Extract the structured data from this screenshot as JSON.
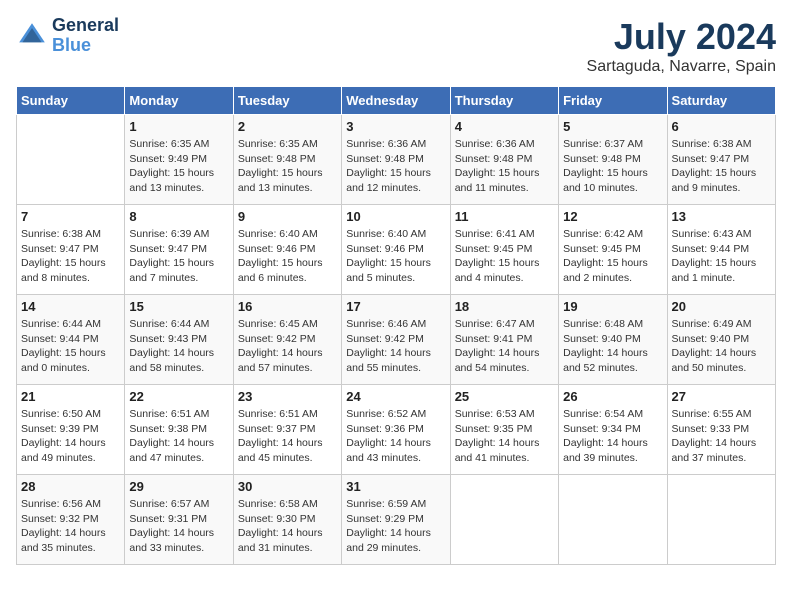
{
  "header": {
    "logo_line1": "General",
    "logo_line2": "Blue",
    "month_year": "July 2024",
    "location": "Sartaguda, Navarre, Spain"
  },
  "days_of_week": [
    "Sunday",
    "Monday",
    "Tuesday",
    "Wednesday",
    "Thursday",
    "Friday",
    "Saturday"
  ],
  "weeks": [
    [
      {
        "day": "",
        "info": ""
      },
      {
        "day": "1",
        "info": "Sunrise: 6:35 AM\nSunset: 9:49 PM\nDaylight: 15 hours\nand 13 minutes."
      },
      {
        "day": "2",
        "info": "Sunrise: 6:35 AM\nSunset: 9:48 PM\nDaylight: 15 hours\nand 13 minutes."
      },
      {
        "day": "3",
        "info": "Sunrise: 6:36 AM\nSunset: 9:48 PM\nDaylight: 15 hours\nand 12 minutes."
      },
      {
        "day": "4",
        "info": "Sunrise: 6:36 AM\nSunset: 9:48 PM\nDaylight: 15 hours\nand 11 minutes."
      },
      {
        "day": "5",
        "info": "Sunrise: 6:37 AM\nSunset: 9:48 PM\nDaylight: 15 hours\nand 10 minutes."
      },
      {
        "day": "6",
        "info": "Sunrise: 6:38 AM\nSunset: 9:47 PM\nDaylight: 15 hours\nand 9 minutes."
      }
    ],
    [
      {
        "day": "7",
        "info": "Sunrise: 6:38 AM\nSunset: 9:47 PM\nDaylight: 15 hours\nand 8 minutes."
      },
      {
        "day": "8",
        "info": "Sunrise: 6:39 AM\nSunset: 9:47 PM\nDaylight: 15 hours\nand 7 minutes."
      },
      {
        "day": "9",
        "info": "Sunrise: 6:40 AM\nSunset: 9:46 PM\nDaylight: 15 hours\nand 6 minutes."
      },
      {
        "day": "10",
        "info": "Sunrise: 6:40 AM\nSunset: 9:46 PM\nDaylight: 15 hours\nand 5 minutes."
      },
      {
        "day": "11",
        "info": "Sunrise: 6:41 AM\nSunset: 9:45 PM\nDaylight: 15 hours\nand 4 minutes."
      },
      {
        "day": "12",
        "info": "Sunrise: 6:42 AM\nSunset: 9:45 PM\nDaylight: 15 hours\nand 2 minutes."
      },
      {
        "day": "13",
        "info": "Sunrise: 6:43 AM\nSunset: 9:44 PM\nDaylight: 15 hours\nand 1 minute."
      }
    ],
    [
      {
        "day": "14",
        "info": "Sunrise: 6:44 AM\nSunset: 9:44 PM\nDaylight: 15 hours\nand 0 minutes."
      },
      {
        "day": "15",
        "info": "Sunrise: 6:44 AM\nSunset: 9:43 PM\nDaylight: 14 hours\nand 58 minutes."
      },
      {
        "day": "16",
        "info": "Sunrise: 6:45 AM\nSunset: 9:42 PM\nDaylight: 14 hours\nand 57 minutes."
      },
      {
        "day": "17",
        "info": "Sunrise: 6:46 AM\nSunset: 9:42 PM\nDaylight: 14 hours\nand 55 minutes."
      },
      {
        "day": "18",
        "info": "Sunrise: 6:47 AM\nSunset: 9:41 PM\nDaylight: 14 hours\nand 54 minutes."
      },
      {
        "day": "19",
        "info": "Sunrise: 6:48 AM\nSunset: 9:40 PM\nDaylight: 14 hours\nand 52 minutes."
      },
      {
        "day": "20",
        "info": "Sunrise: 6:49 AM\nSunset: 9:40 PM\nDaylight: 14 hours\nand 50 minutes."
      }
    ],
    [
      {
        "day": "21",
        "info": "Sunrise: 6:50 AM\nSunset: 9:39 PM\nDaylight: 14 hours\nand 49 minutes."
      },
      {
        "day": "22",
        "info": "Sunrise: 6:51 AM\nSunset: 9:38 PM\nDaylight: 14 hours\nand 47 minutes."
      },
      {
        "day": "23",
        "info": "Sunrise: 6:51 AM\nSunset: 9:37 PM\nDaylight: 14 hours\nand 45 minutes."
      },
      {
        "day": "24",
        "info": "Sunrise: 6:52 AM\nSunset: 9:36 PM\nDaylight: 14 hours\nand 43 minutes."
      },
      {
        "day": "25",
        "info": "Sunrise: 6:53 AM\nSunset: 9:35 PM\nDaylight: 14 hours\nand 41 minutes."
      },
      {
        "day": "26",
        "info": "Sunrise: 6:54 AM\nSunset: 9:34 PM\nDaylight: 14 hours\nand 39 minutes."
      },
      {
        "day": "27",
        "info": "Sunrise: 6:55 AM\nSunset: 9:33 PM\nDaylight: 14 hours\nand 37 minutes."
      }
    ],
    [
      {
        "day": "28",
        "info": "Sunrise: 6:56 AM\nSunset: 9:32 PM\nDaylight: 14 hours\nand 35 minutes."
      },
      {
        "day": "29",
        "info": "Sunrise: 6:57 AM\nSunset: 9:31 PM\nDaylight: 14 hours\nand 33 minutes."
      },
      {
        "day": "30",
        "info": "Sunrise: 6:58 AM\nSunset: 9:30 PM\nDaylight: 14 hours\nand 31 minutes."
      },
      {
        "day": "31",
        "info": "Sunrise: 6:59 AM\nSunset: 9:29 PM\nDaylight: 14 hours\nand 29 minutes."
      },
      {
        "day": "",
        "info": ""
      },
      {
        "day": "",
        "info": ""
      },
      {
        "day": "",
        "info": ""
      }
    ]
  ]
}
